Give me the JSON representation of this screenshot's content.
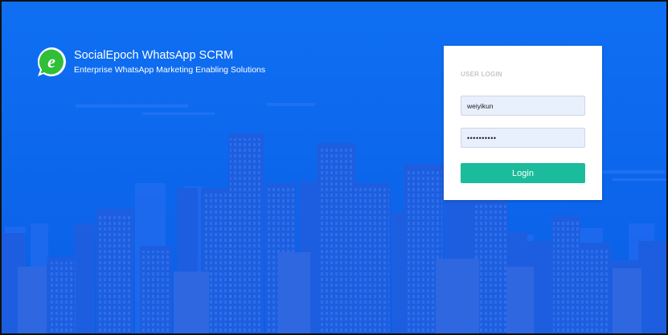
{
  "brand": {
    "title": "SocialEpoch WhatsApp SCRM",
    "subtitle": "Enterprise WhatsApp Marketing Enabling Solutions",
    "logo_letter": "e",
    "logo_color": "#2fbf39"
  },
  "login": {
    "heading": "USER LOGIN",
    "username": "weiyikun",
    "password": "••••••••••",
    "button_label": "Login",
    "button_color": "#1bbc9b"
  },
  "background": {
    "color": "#0c66ec",
    "building_color": "#1a57d8"
  }
}
